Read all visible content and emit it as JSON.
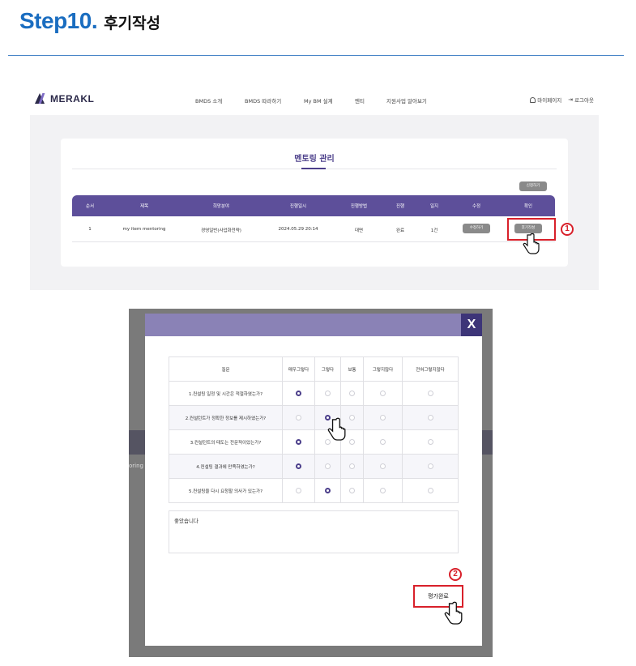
{
  "step": {
    "number": "Step10.",
    "title": "후기작성"
  },
  "site": {
    "logo": "MERAKL",
    "menu": [
      "BMDS 소개",
      "BMDS 따라하기",
      "My BM 설계",
      "멘티",
      "지원사업 알아보기"
    ],
    "user_links": {
      "mypage": "마이페이지",
      "logout": "로그아웃"
    }
  },
  "mentoring": {
    "title": "멘토링 관리",
    "apply_label": "신청하기",
    "columns": [
      "순서",
      "제목",
      "희망분야",
      "진행일시",
      "진행방법",
      "진행",
      "일지",
      "수정",
      "확인"
    ],
    "rows": [
      {
        "no": "1",
        "title": "my item mentoring",
        "field": "경영일반(사업화전략)",
        "datetime": "2024.05.29 20:14",
        "method": "대면",
        "status": "완료",
        "log": "1건",
        "edit_label": "수정하기",
        "confirm_label": "후기작성"
      }
    ]
  },
  "callouts": {
    "one": "1",
    "two": "2"
  },
  "modal": {
    "close_label": "X",
    "background_text": "oring",
    "survey": {
      "header": [
        "질문",
        "매우그렇다",
        "그렇다",
        "보통",
        "그렇지않다",
        "전혀그렇지않다"
      ],
      "questions": [
        {
          "text": "1.컨설팅 일정 및 시간은 적절하였는가?",
          "selected": 0
        },
        {
          "text": "2.컨설턴트가 정확한 정보를 제시하였는가?",
          "selected": 1
        },
        {
          "text": "3.컨설턴트의 태도는 전문적이었는가?",
          "selected": 0
        },
        {
          "text": "4.컨설팅 결과에 만족하였는가?",
          "selected": 0
        },
        {
          "text": "5.컨설팅을 다시 요청할 의사가 있는가?",
          "selected": 1
        }
      ]
    },
    "comment": "좋았습니다",
    "submit_label": "평가완료"
  },
  "colors": {
    "step_blue": "#1a6dc0",
    "purple": "#5d4f9a",
    "callout_red": "#d8202a"
  }
}
